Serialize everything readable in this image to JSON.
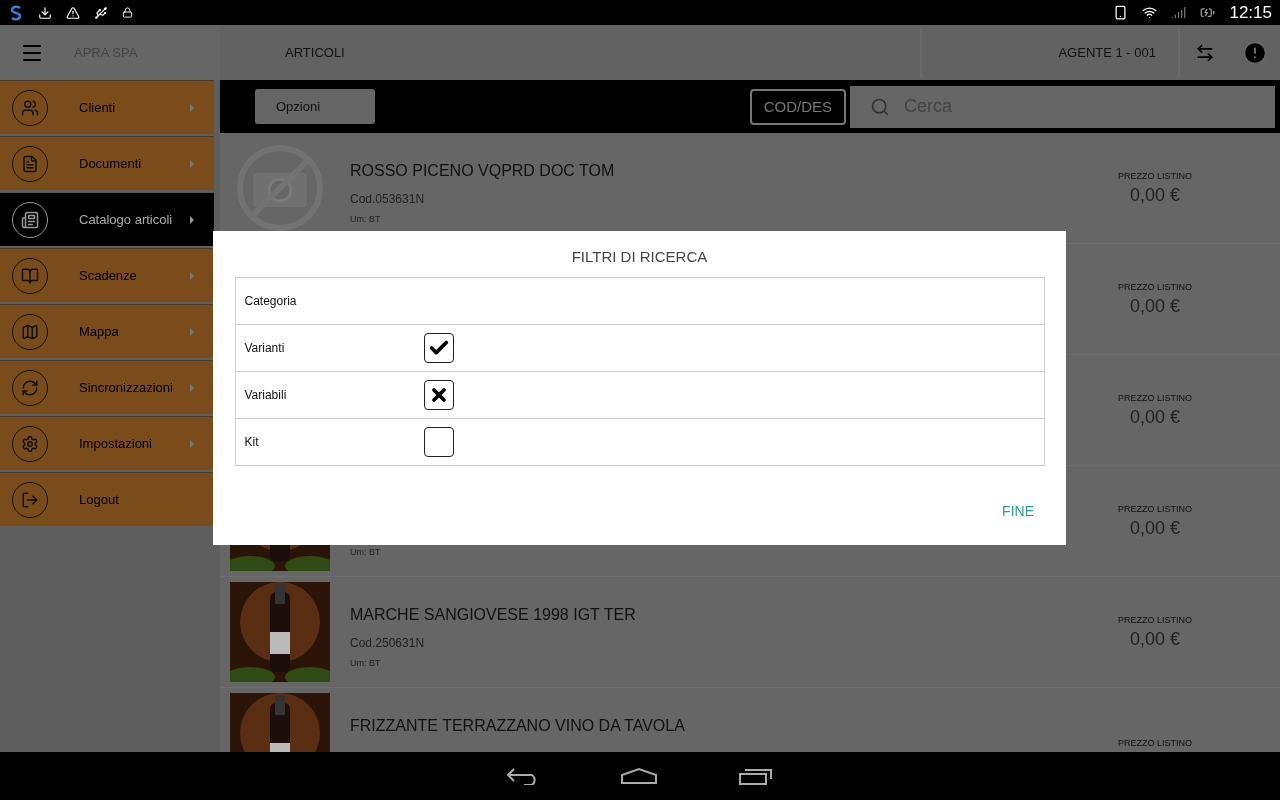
{
  "status_bar": {
    "time": "12:15"
  },
  "sidebar": {
    "title": "APRA SPA",
    "items": [
      {
        "label": "Clienti",
        "selected": false
      },
      {
        "label": "Documenti",
        "selected": false
      },
      {
        "label": "Catalogo articoli",
        "selected": true
      },
      {
        "label": "Scadenze",
        "selected": false
      },
      {
        "label": "Mappa",
        "selected": false
      },
      {
        "label": "Sincronizzazioni",
        "selected": false
      },
      {
        "label": "Impostazioni",
        "selected": false
      },
      {
        "label": "Logout",
        "selected": false
      }
    ]
  },
  "header": {
    "title": "ARTICOLI",
    "agent": "AGENTE 1 - 001"
  },
  "toolbar": {
    "options_button": "Opzioni",
    "mode_button": "COD/DES",
    "search": {
      "placeholder": "Cerca"
    }
  },
  "articles": [
    {
      "kind": "no_photo",
      "title": "ROSSO PICENO VQPRD DOC TOM",
      "code": "Cod.053631N",
      "unit": "Um: BT",
      "price_label": "PREZZO LISTINO",
      "price": "0,00 €"
    },
    {
      "price_label": "PREZZO LISTINO",
      "price": "0,00 €"
    },
    {
      "price_label": "PREZZO LISTINO",
      "price": "0,00 €"
    },
    {
      "kind": "picture",
      "unit": "Um: BT",
      "price_label": "PREZZO LISTINO",
      "price": "0,00 €"
    },
    {
      "kind": "picture",
      "title": "MARCHE SANGIOVESE 1998 IGT TER",
      "code": "Cod.250631N",
      "unit": "Um: BT",
      "price_label": "PREZZO LISTINO",
      "price": "0,00 €"
    },
    {
      "kind": "picture",
      "title": "FRIZZANTE TERRAZZANO VINO DA TAVOLA",
      "price_label": "PREZZO LISTINO"
    }
  ],
  "dialog": {
    "title": "FILTRI DI RICERCA",
    "rows": [
      {
        "kind": "text",
        "label": "Categoria"
      },
      {
        "kind": "checkbox",
        "label": "Varianti",
        "checked": true,
        "crossed": false
      },
      {
        "kind": "checkbox",
        "label": "Variabili",
        "checked": false,
        "crossed": true
      },
      {
        "kind": "checkbox",
        "label": "Kit",
        "checked": false,
        "crossed": false
      }
    ],
    "done_button": "FINE"
  }
}
